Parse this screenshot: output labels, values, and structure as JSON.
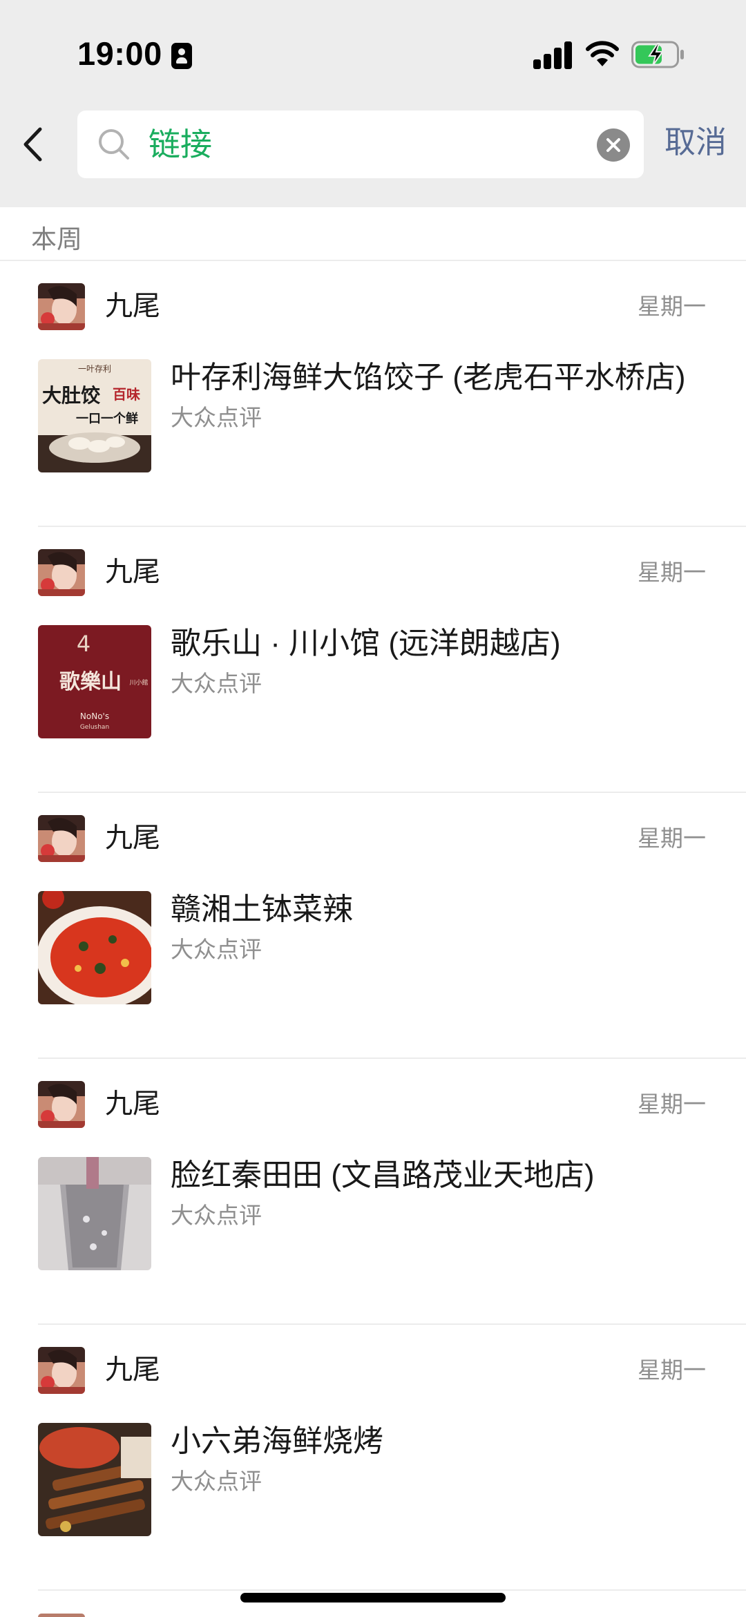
{
  "status_bar": {
    "time": "19:00",
    "icons": [
      "person-id-icon",
      "cellular-signal-icon",
      "wifi-icon",
      "battery-charging-icon"
    ],
    "battery_color": "#34c759"
  },
  "search": {
    "query": "链接",
    "cancel_label": "取消",
    "query_color": "#1aad5e"
  },
  "section": {
    "label": "本周"
  },
  "messages": [
    {
      "sender": "九尾",
      "date": "星期一",
      "title": "叶存利海鲜大馅饺子 (老虎石平水桥店)",
      "source": "大众点评",
      "thumbnail_text": [
        "一叶存利",
        "大肚饺",
        "百味",
        "一口一个鲜"
      ]
    },
    {
      "sender": "九尾",
      "date": "星期一",
      "title": "歌乐山 · 川小馆 (远洋朗越店)",
      "source": "大众点评",
      "thumbnail_text": [
        "4",
        "歌樂山",
        "川小館",
        "NoNo's",
        "Gelushan"
      ]
    },
    {
      "sender": "九尾",
      "date": "星期一",
      "title": "赣湘土钵菜辣",
      "source": "大众点评"
    },
    {
      "sender": "九尾",
      "date": "星期一",
      "title": "脸红秦田田 (文昌路茂业天地店)",
      "source": "大众点评"
    },
    {
      "sender": "九尾",
      "date": "星期一",
      "title": "小六弟海鲜烧烤",
      "source": "大众点评"
    }
  ]
}
